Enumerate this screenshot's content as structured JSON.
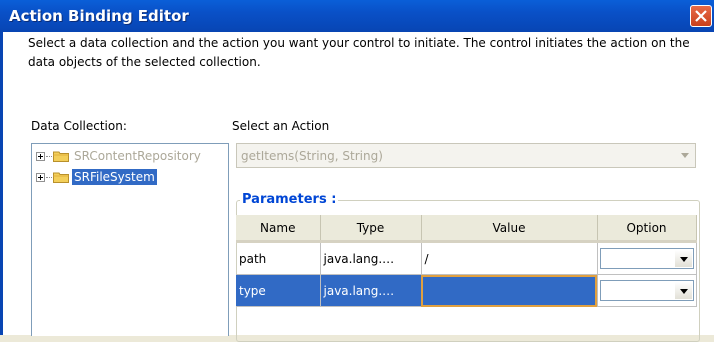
{
  "window": {
    "title": "Action Binding Editor"
  },
  "description": "Select a data collection and the action you want your control to initiate. The control initiates the action on the data objects of the selected collection.",
  "data_collection": {
    "label": "Data Collection:",
    "items": [
      {
        "label": "SRContentRepository",
        "state": "disabled"
      },
      {
        "label": "SRFileSystem",
        "state": "selected"
      }
    ]
  },
  "action": {
    "label": "Select an Action",
    "selected": "getItems(String, String)"
  },
  "parameters": {
    "title": "Parameters :",
    "columns": [
      "Name",
      "Type",
      "Value",
      "Option"
    ],
    "rows": [
      {
        "name": "path",
        "type": "java.lang.…",
        "value": "/",
        "option": ""
      },
      {
        "name": "type",
        "type": "java.lang.…",
        "value": "",
        "option": ""
      }
    ]
  },
  "colors": {
    "title_bar": "#0950c7",
    "selection": "#316ac5",
    "group_title": "#0046d5"
  }
}
